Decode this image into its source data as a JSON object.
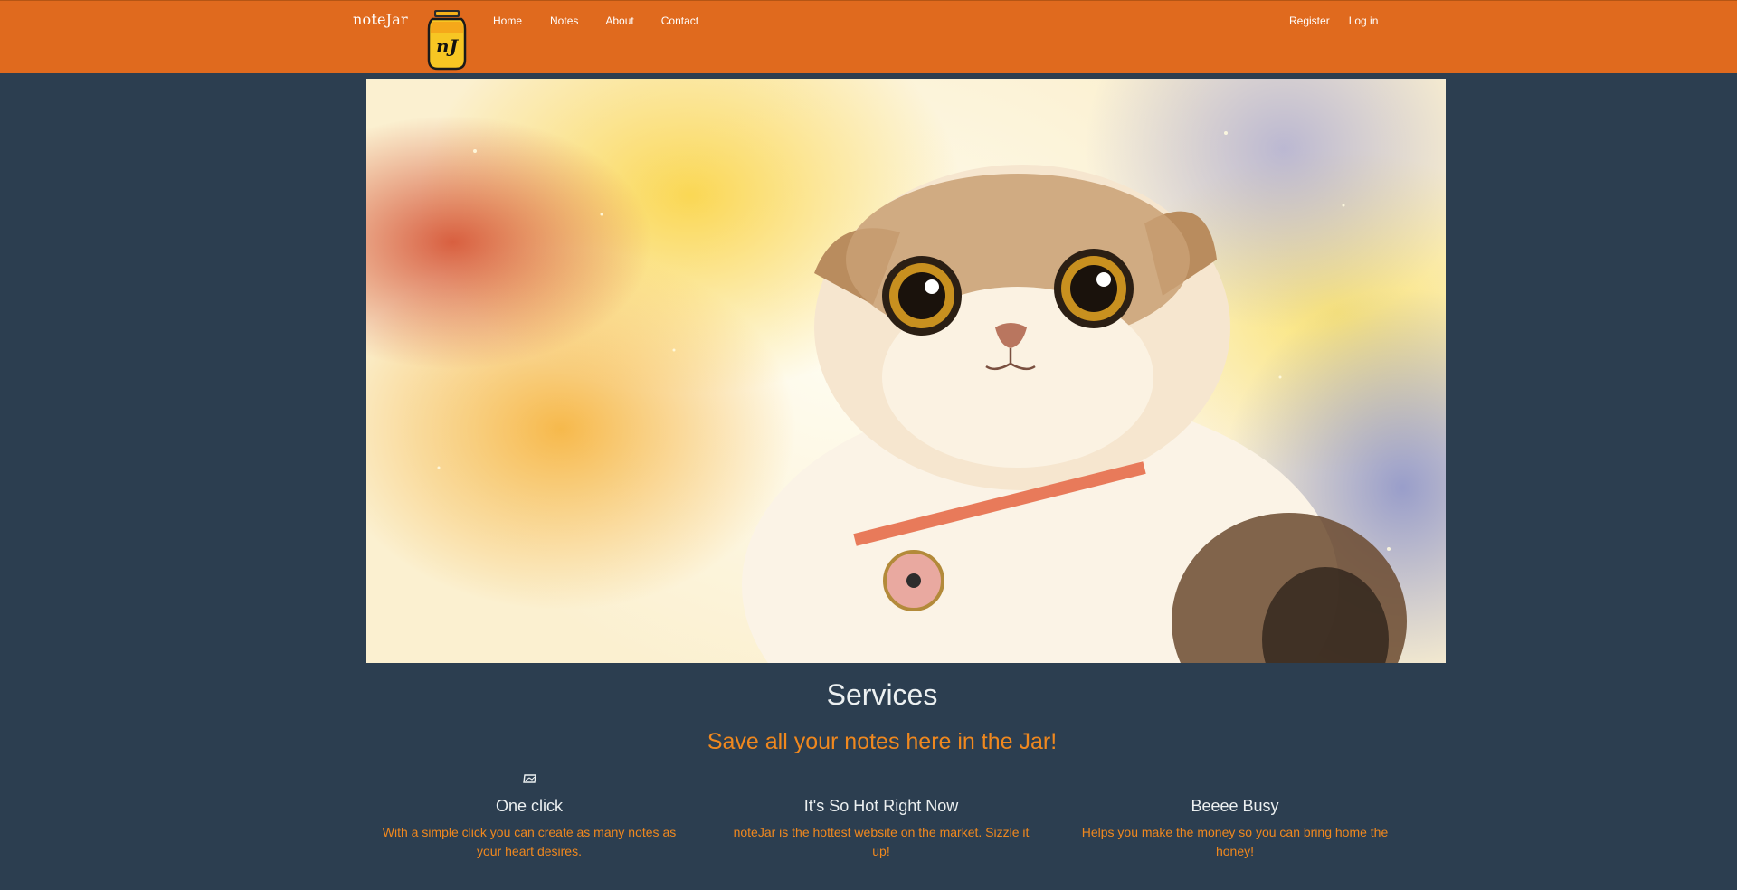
{
  "navbar": {
    "brand": "noteJar",
    "logo_text": "nJ",
    "left_links": [
      "Home",
      "Notes",
      "About",
      "Contact"
    ],
    "right_links": [
      "Register",
      "Log in"
    ],
    "background_color": "#e06a1e"
  },
  "hero": {
    "image": "cat-in-space-icon"
  },
  "services": {
    "title": "Services",
    "subtitle": "Save all your notes here in the Jar!",
    "icon": "broken-image-icon",
    "items": [
      {
        "title": "One click",
        "text": "With a simple click you can create as many notes as your heart desires."
      },
      {
        "title": "It's So Hot Right Now",
        "text": "noteJar is the hottest website on the market. Sizzle it up!"
      },
      {
        "title": "Beeee Busy",
        "text": "Helps you make the money so you can bring home the honey!"
      }
    ]
  },
  "colors": {
    "page_background": "#2c3e50",
    "accent": "#f0881e",
    "heading_text": "#ecf0f1"
  }
}
